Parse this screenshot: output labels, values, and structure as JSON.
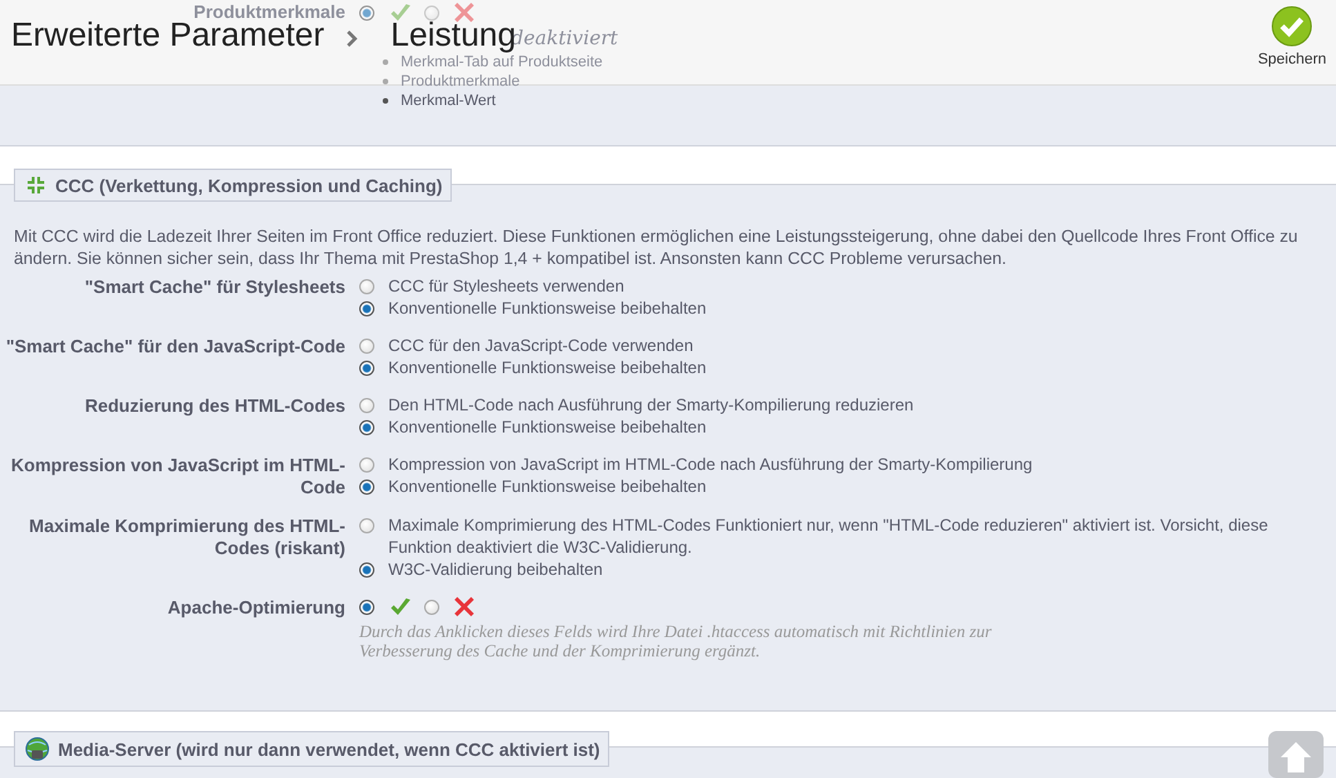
{
  "header": {
    "breadcrumb": [
      "Erweiterte Parameter",
      "Leistung"
    ],
    "save_button": {
      "label": "Speichern"
    }
  },
  "features_section": {
    "label": "Produktmerkmale",
    "on": true,
    "note": "deaktiviert",
    "items": [
      "Merkmal-Tab auf Produktseite",
      "Produktmerkmale",
      "Merkmal-Wert"
    ]
  },
  "ccc": {
    "title": "CCC (Verkettung, Kompression und Caching)",
    "description": "Mit CCC wird die Ladezeit Ihrer Seiten im Front Office reduziert. Diese Funktionen ermöglichen eine Leistungssteigerung, ohne dabei den Quellcode Ihres Front Office zu ändern. Sie können sicher sein, dass Ihr Thema mit PrestaShop 1,4 + kompatibel ist. Ansonsten kann CCC Probleme verursachen.",
    "rows": [
      {
        "kind": "radio",
        "label": "\"Smart Cache\" für Stylesheets",
        "options": [
          {
            "label": "CCC für Stylesheets verwenden",
            "selected": false
          },
          {
            "label": "Konventionelle Funktionsweise beibehalten",
            "selected": true
          }
        ]
      },
      {
        "kind": "radio",
        "label": "\"Smart Cache\" für den JavaScript-Code",
        "options": [
          {
            "label": "CCC für den JavaScript-Code verwenden",
            "selected": false
          },
          {
            "label": "Konventionelle Funktionsweise beibehalten",
            "selected": true
          }
        ]
      },
      {
        "kind": "radio",
        "label": "Reduzierung des HTML-Codes",
        "options": [
          {
            "label": "Den HTML-Code nach Ausführung der Smarty-Kompilierung reduzieren",
            "selected": false
          },
          {
            "label": "Konventionelle Funktionsweise beibehalten",
            "selected": true
          }
        ]
      },
      {
        "kind": "radio",
        "label": "Kompression von JavaScript im HTML-Code",
        "options": [
          {
            "label": "Kompression von JavaScript im HTML-Code nach Ausführung der Smarty-Kompilierung",
            "selected": false
          },
          {
            "label": "Konventionelle Funktionsweise beibehalten",
            "selected": true
          }
        ]
      },
      {
        "kind": "radio",
        "label": "Maximale Komprimierung des HTML-Codes (riskant)",
        "options": [
          {
            "label": "Maximale Komprimierung des HTML-Codes Funktioniert nur, wenn \"HTML-Code reduzieren\" aktiviert ist. Vorsicht, diese Funktion deaktiviert die W3C-Validierung.",
            "selected": false
          },
          {
            "label": "W3C-Validierung beibehalten",
            "selected": true
          }
        ]
      },
      {
        "kind": "toggle",
        "label": "Apache-Optimierung",
        "on": true,
        "hint": "Durch das Anklicken dieses Felds wird Ihre Datei .htaccess automatisch mit Richtlinien zur Verbesserung des Cache und der Komprimierung ergänzt."
      }
    ]
  },
  "media_server": {
    "title": "Media-Server (wird nur dann verwendet, wenn CCC aktiviert ist)"
  }
}
